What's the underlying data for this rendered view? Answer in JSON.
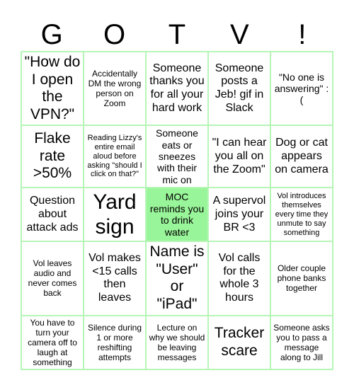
{
  "header": {
    "letters": [
      "G",
      "O",
      "T",
      "V",
      "!"
    ]
  },
  "board": {
    "rows": [
      [
        {
          "text": "\"How do I open the VPN?\"",
          "marked": false
        },
        {
          "text": "Accidentally DM the wrong person on Zoom",
          "marked": false
        },
        {
          "text": "Someone thanks you for all your hard work",
          "marked": false
        },
        {
          "text": "Someone posts a Jeb! gif in Slack",
          "marked": false
        },
        {
          "text": "\"No one is answering\" :(",
          "marked": false
        }
      ],
      [
        {
          "text": "Flake rate >50%",
          "marked": false
        },
        {
          "text": "Reading Lizzy's entire email aloud before asking \"should I click on that?\"",
          "marked": false
        },
        {
          "text": "Someone eats or sneezes with their mic on",
          "marked": false
        },
        {
          "text": "\"I can hear you all on the Zoom\"",
          "marked": false
        },
        {
          "text": "Dog or cat appears on camera",
          "marked": false
        }
      ],
      [
        {
          "text": "Question about attack ads",
          "marked": false
        },
        {
          "text": "Yard sign",
          "marked": false
        },
        {
          "text": "MOC reminds you to drink water",
          "marked": true
        },
        {
          "text": "A supervol joins your BR <3",
          "marked": false
        },
        {
          "text": "Vol introduces themselves every time they unmute to say something",
          "marked": false
        }
      ],
      [
        {
          "text": "Vol leaves audio and never comes back",
          "marked": false
        },
        {
          "text": "Vol makes <15 calls then leaves",
          "marked": false
        },
        {
          "text": "Name is \"User\" or \"iPad\"",
          "marked": false
        },
        {
          "text": "Vol calls for the whole 3 hours",
          "marked": false
        },
        {
          "text": "Older couple phone banks together",
          "marked": false
        }
      ],
      [
        {
          "text": "You have to turn your camera off to laugh at something",
          "marked": false
        },
        {
          "text": "Silence during 1 or more reshifting attempts",
          "marked": false
        },
        {
          "text": "Lecture on why we should be leaving messages",
          "marked": false
        },
        {
          "text": "Tracker scare",
          "marked": false
        },
        {
          "text": "Someone asks you to pass a message along to Jill",
          "marked": false
        }
      ]
    ]
  },
  "colors": {
    "grid_line": "#b6f5b6",
    "marked_fill": "#99f599"
  }
}
